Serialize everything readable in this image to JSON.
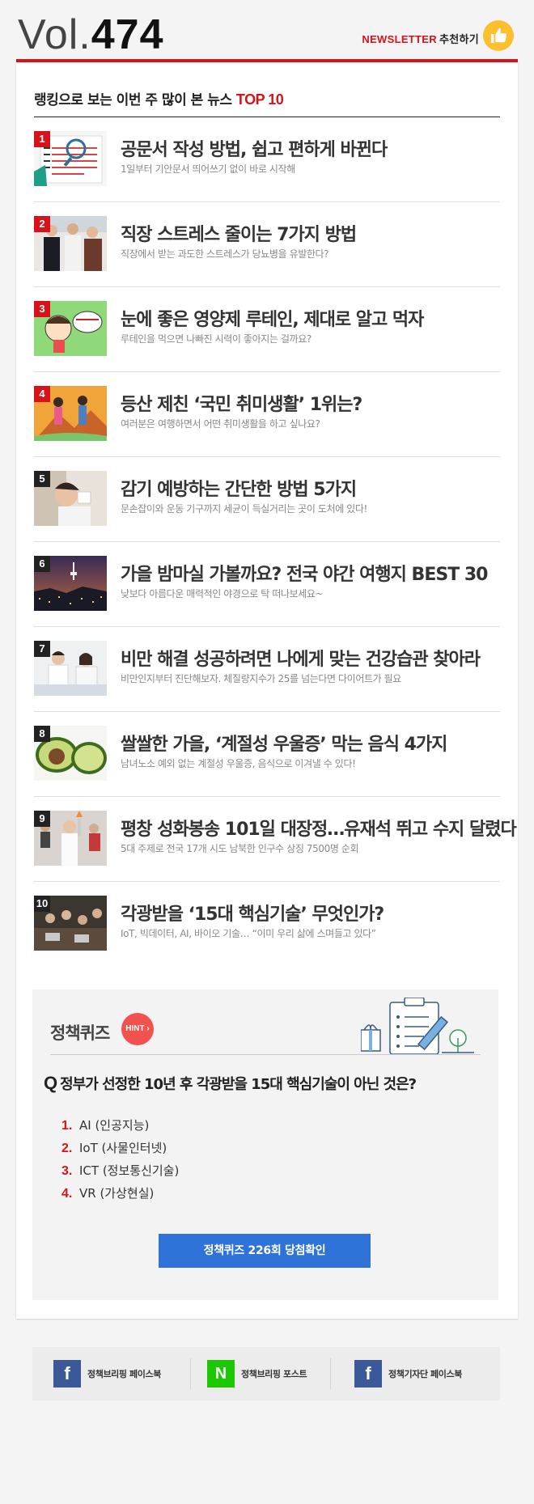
{
  "header": {
    "vol_prefix": "Vol.",
    "vol_number": "474",
    "newsletter_label": "NEWSLETTER",
    "recommend_label": "추천하기"
  },
  "ranking": {
    "title_prefix": "랭킹으로 보는 이번 주 많이 본 뉴스",
    "title_top": "TOP 10",
    "items": [
      {
        "rank": "1",
        "title": "공문서 작성 방법, 쉽고 편하게 바뀐다",
        "subtitle": "1일부터 기안문서 띄어쓰기 없이 바로 시작해"
      },
      {
        "rank": "2",
        "title": "직장 스트레스 줄이는 7가지 방법",
        "subtitle": "직장에서 받는 과도한 스트레스가 당뇨병을 유발한다?"
      },
      {
        "rank": "3",
        "title": "눈에 좋은 영양제 루테인, 제대로 알고 먹자",
        "subtitle": "루테인을 먹으면 나빠진 시력이 좋아지는 걸까요?"
      },
      {
        "rank": "4",
        "title": "등산 제친 ‘국민 취미생활’ 1위는?",
        "subtitle": "여러분은 여행하면서 어떤 취미생활을 하고 싶나요?"
      },
      {
        "rank": "5",
        "title": "감기 예방하는 간단한 방법 5가지",
        "subtitle": "문손잡이와 운동 기구까지 세균이 득실거리는 곳이 도처에 있다!"
      },
      {
        "rank": "6",
        "title": "가을 밤마실 가볼까요? 전국 야간 여행지 BEST 30",
        "subtitle": "낮보다 아름다운 매력적인 야경으로 탁 떠나보세요~"
      },
      {
        "rank": "7",
        "title": "비만 해결 성공하려면 나에게 맞는 건강습관 찾아라",
        "subtitle": "비만인지부터 진단해보자. 체질량지수가 25를 넘는다면 다이어트가 필요"
      },
      {
        "rank": "8",
        "title": "쌀쌀한 가을, ‘계절성 우울증’ 막는 음식 4가지",
        "subtitle": "남녀노소 예외 없는 계절성 우울증, 음식으로 이겨낼 수 있다!"
      },
      {
        "rank": "9",
        "title": "평창 성화봉송 101일 대장정…유재석 뛰고 수지 달렸다",
        "subtitle": "5대 주제로 전국 17개 시도 남북한 인구수 상징 7500명 순회"
      },
      {
        "rank": "10",
        "title": "각광받을 ‘15대 핵심기술’ 무엇인가?",
        "subtitle": "IoT, 빅데이터, AI, 바이오 기술… “이미 우리 삶에 스며들고 있다”"
      }
    ]
  },
  "quiz": {
    "label": "정책퀴즈",
    "hint": "HINT",
    "question": "정부가 선정한 10년 후 각광받을 15대 핵심기술이 아닌 것은?",
    "q_mark": "Q",
    "options": [
      {
        "num": "1.",
        "text": "AI (인공지능)"
      },
      {
        "num": "2.",
        "text": "IoT (사물인터넷)"
      },
      {
        "num": "3.",
        "text": "ICT (정보통신기술)"
      },
      {
        "num": "4.",
        "text": "VR (가상현실)"
      }
    ],
    "button_label": "정책퀴즈 226회 당첨확인"
  },
  "footer": {
    "links": [
      {
        "icon": "f",
        "label": "정책브리핑 페이스북"
      },
      {
        "icon": "N",
        "label": "정책브리핑 포스트"
      },
      {
        "icon": "f",
        "label": "정책기자단 페이스북"
      }
    ]
  },
  "colors": {
    "accent_red": "#d9121a",
    "button_blue": "#2f72d8",
    "hint_red": "#f0524d",
    "facebook": "#3b5998",
    "naver": "#1ec800",
    "thumb_yellow": "#fcc02e"
  }
}
